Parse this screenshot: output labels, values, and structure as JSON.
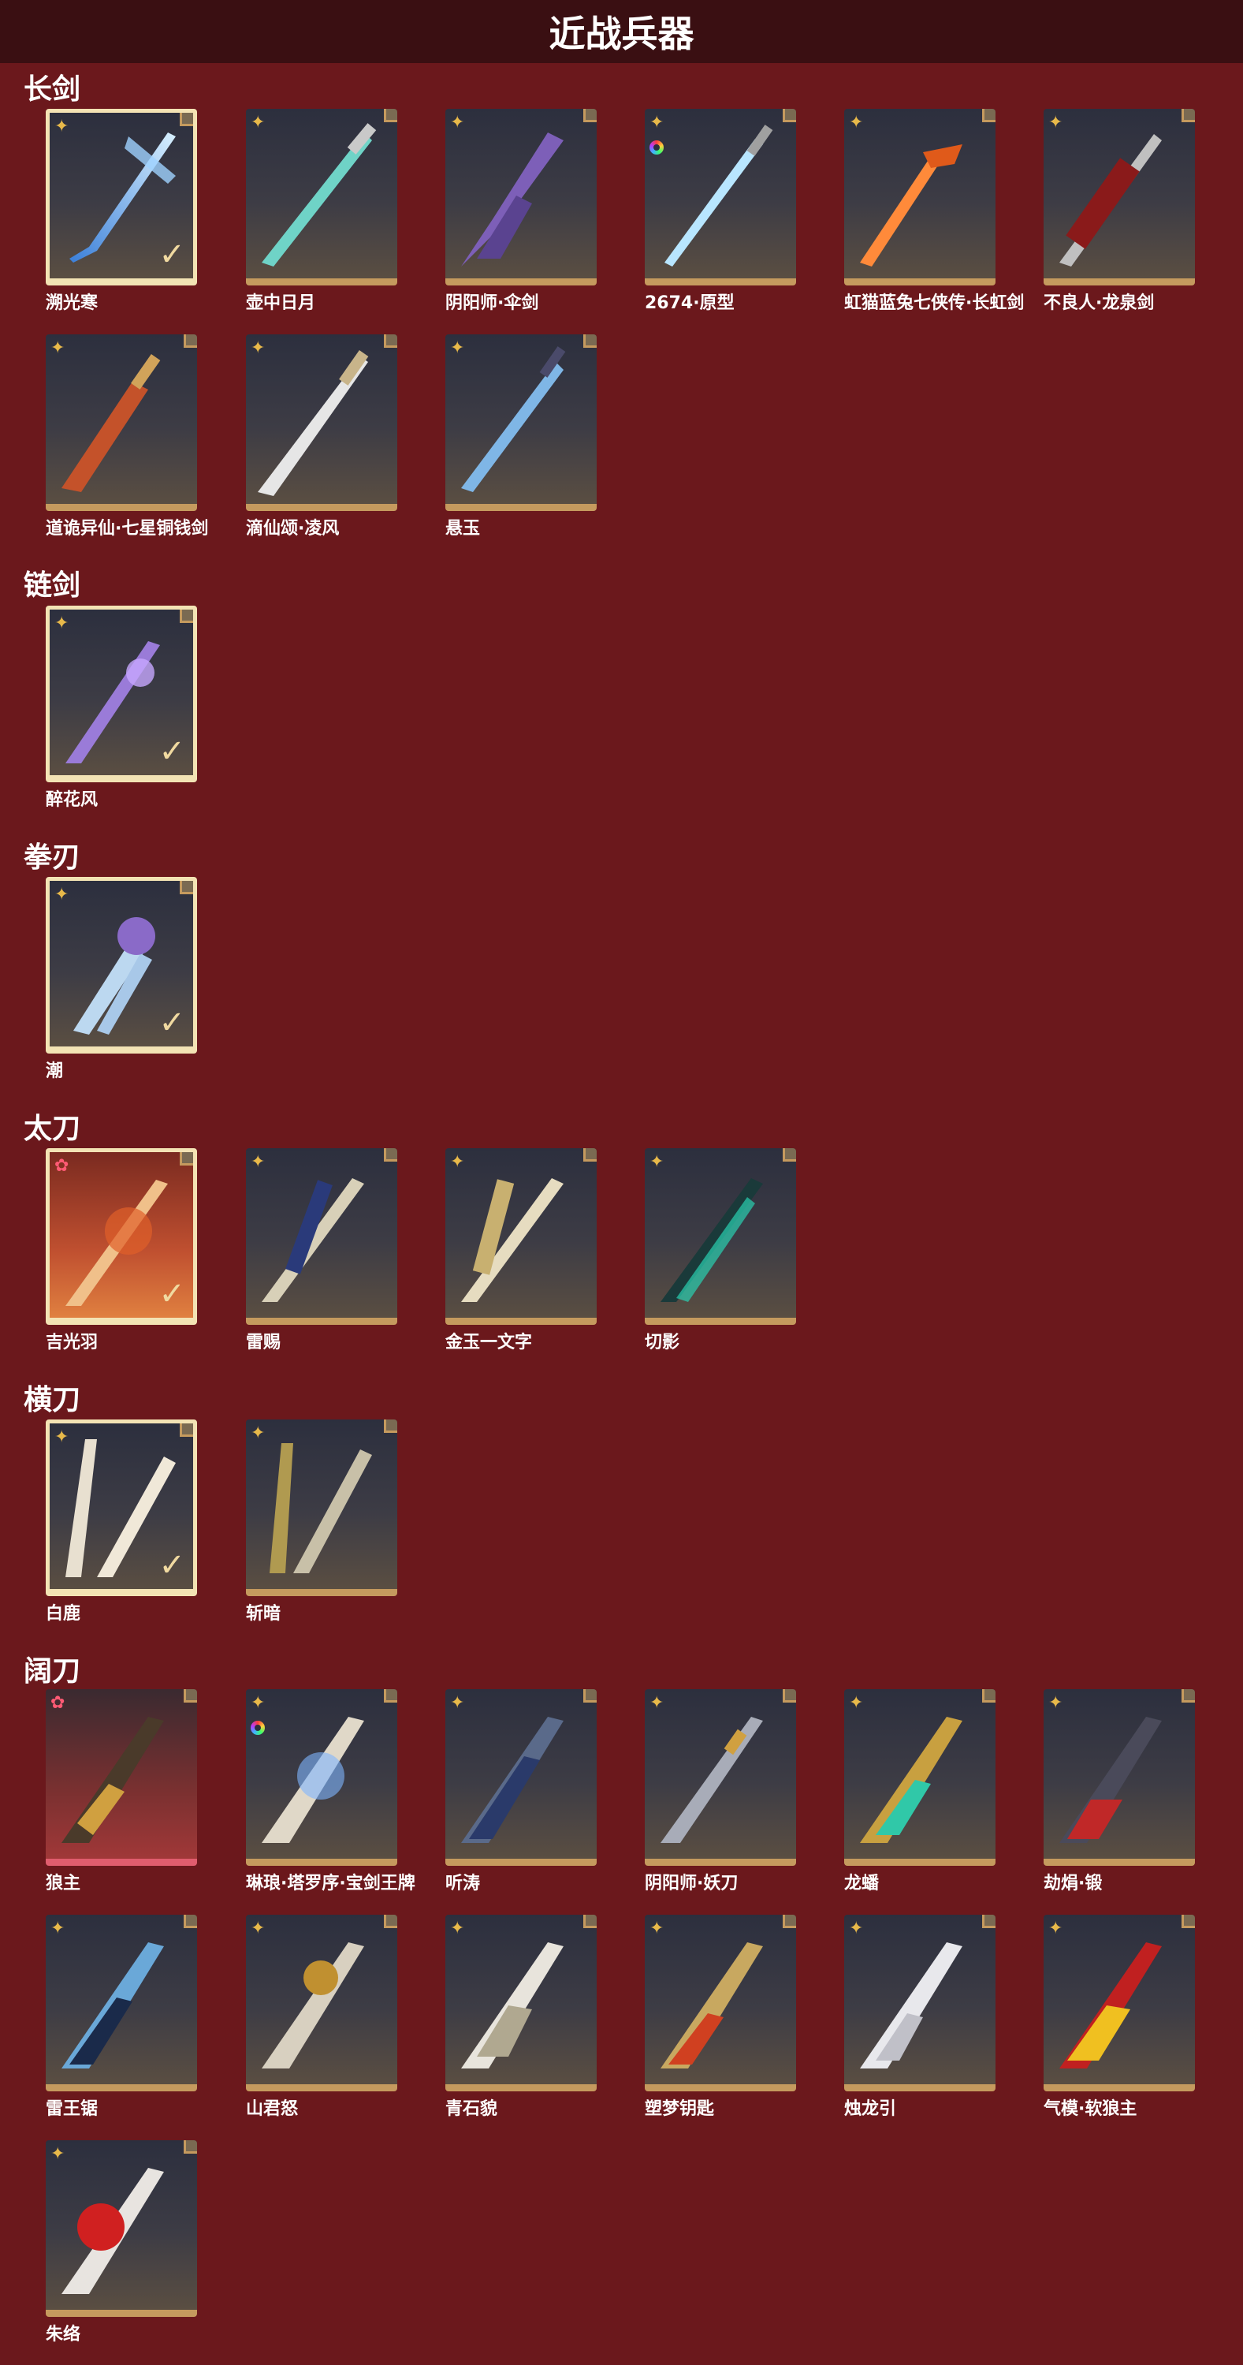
{
  "title": "近战兵器",
  "sections": [
    {
      "title": "长剑"
    },
    {
      "title": "链剑"
    },
    {
      "title": "拳刃"
    },
    {
      "title": "太刀"
    },
    {
      "title": "横刀"
    },
    {
      "title": "阔刀"
    }
  ],
  "items": {
    "s0": [
      "溯光寒",
      "壶中日月",
      "阴阳师·伞剑",
      "2674·原型",
      "虹猫蓝兔七侠传·长虹剑",
      "不良人·龙泉剑",
      "道诡异仙·七星铜钱剑",
      "滴仙颂·凌风",
      "悬玉"
    ],
    "s1": [
      "醉花风"
    ],
    "s2": [
      "潮"
    ],
    "s3": [
      "吉光羽",
      "雷赐",
      "金玉一文字",
      "切影"
    ],
    "s4": [
      "白鹿",
      "斩暗"
    ],
    "s5": [
      "狼主",
      "琳琅·塔罗序·宝剑王牌",
      "听涛",
      "阴阳师·妖刀",
      "龙蟠",
      "劫焆·锻",
      "雷王锯",
      "山君怒",
      "青石貌",
      "塑梦钥匙",
      "烛龙引",
      "气模·软狼主",
      "朱络"
    ]
  },
  "icons": {
    "badge_gold": "four-point-star-icon",
    "badge_pink": "pink-star-icon",
    "badge_ring": "rainbow-ring-icon",
    "selected_mark": "checkmark-icon"
  },
  "colors": {
    "background": "#6b181c",
    "header": "#3a0f12",
    "tile_border": "#c59a5e",
    "selected_border": "#f3e3b4",
    "gold_badge": "#e8b94a",
    "pink_badge": "#ff5a74"
  }
}
